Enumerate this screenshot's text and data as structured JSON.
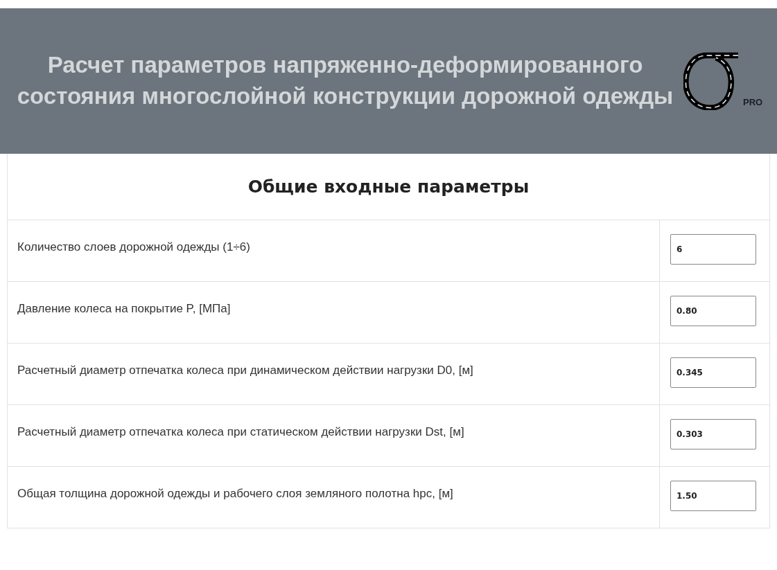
{
  "header": {
    "title": "Расчет параметров напряженно-деформированного состояния многослойной конструкции дорожной одежды",
    "logo_badge": "PRO"
  },
  "section": {
    "title": "Общие входные параметры"
  },
  "params": [
    {
      "label": "Количество слоев дорожной одежды (1÷6)",
      "value": "6"
    },
    {
      "label": "Давление колеса на покрытие P, [МПа]",
      "value": "0.80"
    },
    {
      "label": "Расчетный диаметр отпечатка колеса при динамическом действии нагрузки D0, [м]",
      "value": "0.345"
    },
    {
      "label": "Расчетный диаметр отпечатка колеса при статическом действии нагрузки Dst, [м]",
      "value": "0.303"
    },
    {
      "label": "Общая толщина дорожной одежды и рабочего слоя земляного полотна hpc, [м]",
      "value": "1.50"
    }
  ]
}
